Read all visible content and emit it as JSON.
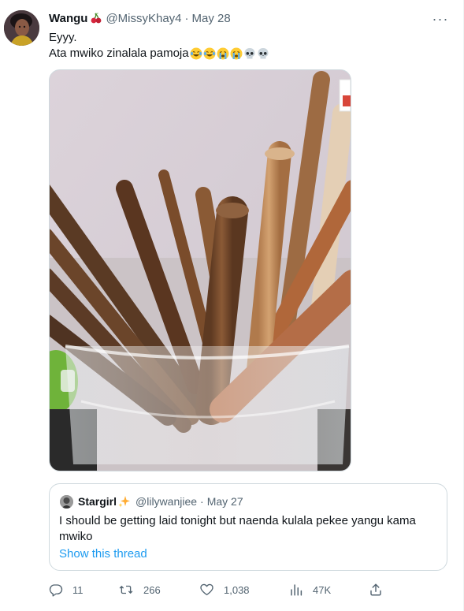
{
  "tweet": {
    "author_name": "Wangu",
    "author_handle": "@MissyKhay4",
    "separator": "·",
    "date": "May 28",
    "text_line1": "Eyyy.",
    "text_line2": "Ata mwiko zinalala pamoja",
    "more_label": "···",
    "icons": {
      "name_badge": "cherry-icon",
      "emojis": [
        "joy-emoji",
        "joy-emoji",
        "crying-emoji",
        "crying-emoji",
        "skull-emoji",
        "skull-emoji"
      ]
    }
  },
  "quote": {
    "author_name": "Stargirl",
    "author_handle": "@lilywanjiee",
    "separator": "·",
    "date": "May 27",
    "text": "I should be getting laid tonight but naenda kulala pekee yangu kama mwiko",
    "show_thread": "Show this thread",
    "badge_icon": "sparkles-icon"
  },
  "actions": {
    "replies": "11",
    "retweets": "266",
    "likes": "1,038",
    "views": "47K"
  },
  "colors": {
    "text": "#0f1419",
    "secondary": "#536471",
    "link": "#1d9bf0",
    "border": "#cfd9de"
  }
}
